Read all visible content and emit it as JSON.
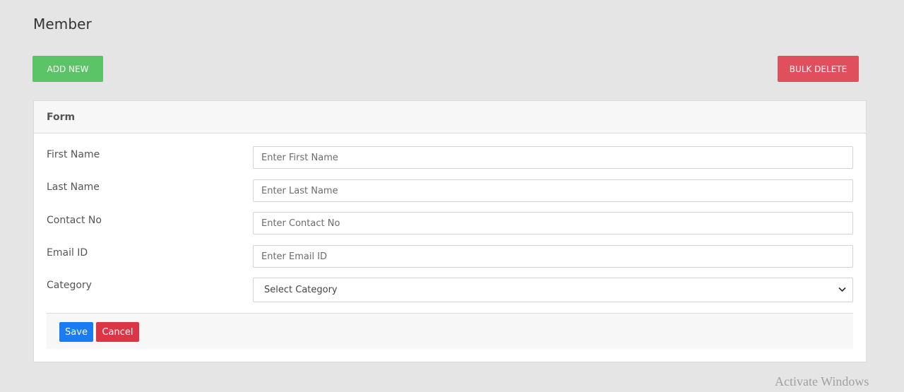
{
  "page": {
    "title": "Member"
  },
  "toolbar": {
    "add_new_label": "ADD NEW",
    "bulk_delete_label": "BULK DELETE"
  },
  "form": {
    "header": "Form",
    "fields": {
      "first_name": {
        "label": "First Name",
        "placeholder": "Enter First Name",
        "value": ""
      },
      "last_name": {
        "label": "Last Name",
        "placeholder": "Enter Last Name",
        "value": ""
      },
      "contact_no": {
        "label": "Contact No",
        "placeholder": "Enter Contact No",
        "value": ""
      },
      "email_id": {
        "label": "Email ID",
        "placeholder": "Enter Email ID",
        "value": ""
      },
      "category": {
        "label": "Category",
        "selected": "Select Category"
      }
    },
    "save_label": "Save",
    "cancel_label": "Cancel"
  },
  "watermark": {
    "text": "Activate Windows"
  },
  "colors": {
    "background": "#e5e5e5",
    "add_new": "#5bc466",
    "bulk_delete": "#e0505c",
    "save": "#1a7cf2",
    "cancel": "#dc3545"
  },
  "icons": {
    "select_chevron": "chevron-down-icon"
  }
}
